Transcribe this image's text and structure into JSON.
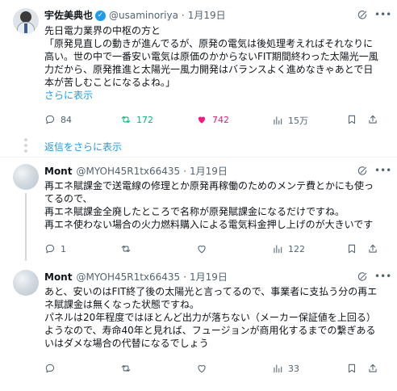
{
  "main_post": {
    "author_name": "宇佐美典也",
    "author_handle": "@usaminoriya",
    "separator": "·",
    "date": "1月19日",
    "lines": [
      "先日電力業界の中枢の方と",
      "「原発見直しの動きが進んでるが、原発の電気は後処理考えればそれなりに",
      "高い。世の中で一番安い電気は原価のかからないFIT期間終わった太陽光一風",
      "力だから、原発推進と太陽光一風力開発はバランスよく進めなきゃあとで日",
      "本が苦しむことになるよね。」"
    ],
    "show_more": "さらに表示",
    "stats": {
      "replies": "84",
      "reposts": "172",
      "likes": "742",
      "views": "15万"
    }
  },
  "show_replies": "返信をさらに表示",
  "replies": [
    {
      "author_name": "Mont",
      "author_handle": "@MYOH45R1tx66435",
      "separator": "·",
      "date": "1月19日",
      "lines": [
        "再エネ賦課金で送電線の修理とか原発再稼働のためのメンテ費とかにも使っ",
        "てるので、",
        "再エネ賦課金全廃したところで名称が原発賦課金になるだけですね。",
        "再エネ使わない場合の火力燃料購入による電気料金押し上げのが大きいです"
      ],
      "stats": {
        "replies": "1",
        "reposts": "",
        "likes": "",
        "views": "122"
      }
    },
    {
      "author_name": "Mont",
      "author_handle": "@MYOH45R1tx66435",
      "separator": "·",
      "date": "1月19日",
      "lines": [
        "あと、安いのはFIT終了後の太陽光と言ってるので、事業者に支払う分の再エ",
        "ネ賦課金は無くなった状態ですね。",
        "パネルは20年程度ではほとんど出力が落ちない（メーカー保証値を上回る）",
        "ようなので、寿命40年と見れば、フュージョンが商用化するまでの繋ぎある",
        "いはダメな場合の代替になるでしょう"
      ],
      "stats": {
        "replies": "",
        "reposts": "",
        "likes": "",
        "views": "33"
      }
    }
  ],
  "icons": {
    "verified": "verified-badge-icon",
    "grok": "grok-icon",
    "more": "more-icon",
    "reply": "reply-icon",
    "repost": "repost-icon",
    "like": "heart-icon",
    "views": "views-icon",
    "bookmark": "bookmark-icon",
    "share": "share-icon"
  },
  "colors": {
    "link": "#1d9bf0",
    "repost_active": "#00ba7c",
    "like_active": "#f91880",
    "secondary_text": "#536471"
  }
}
